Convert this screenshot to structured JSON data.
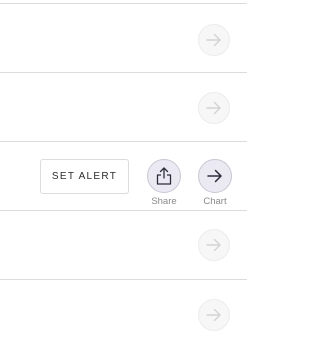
{
  "rows": [
    {
      "arrow_icon": "arrow-right-icon",
      "state": "faded"
    },
    {
      "arrow_icon": "arrow-right-icon",
      "state": "faded"
    },
    {
      "arrow_icon": "arrow-right-icon",
      "state": "active"
    },
    {
      "arrow_icon": "arrow-right-icon",
      "state": "faded"
    },
    {
      "arrow_icon": "arrow-right-icon",
      "state": "faded"
    }
  ],
  "active_row": {
    "set_alert_label": "SET ALERT",
    "share": {
      "label": "Share",
      "icon": "share-icon"
    },
    "chart": {
      "label": "Chart",
      "icon": "arrow-right-icon"
    }
  },
  "colors": {
    "divider": "#dcdcdc",
    "faded_arrow": "#d3d3d3",
    "active_circle_bg": "#ebeaf3",
    "active_icon": "#2c2c3c",
    "label": "#8a8a8a"
  }
}
